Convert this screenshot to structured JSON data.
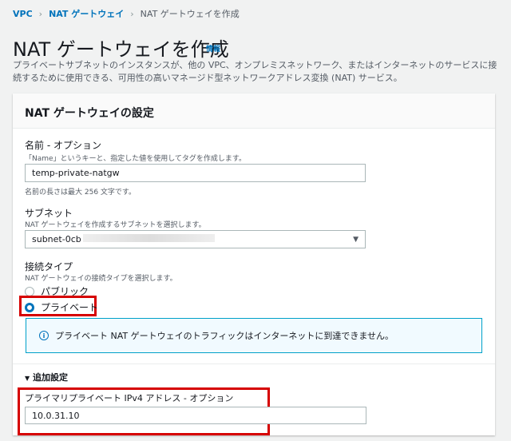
{
  "breadcrumb": {
    "items": [
      "VPC",
      "NAT ゲートウェイ"
    ],
    "current": "NAT ゲートウェイを作成"
  },
  "page": {
    "title": "NAT ゲートウェイを作成",
    "info_link": "情報",
    "description": "プライベートサブネットのインスタンスが、他の VPC、オンプレミスネットワーク、またはインターネットのサービスに接続するために使用できる、可用性の高いマネージド型ネットワークアドレス変換 (NAT) サービス。"
  },
  "settings": {
    "title": "NAT ゲートウェイの設定",
    "name": {
      "label": "名前 - オプション",
      "description": "「Name」というキーと、指定した値を使用してタグを作成します。",
      "value": "temp-private-natgw",
      "hint": "名前の長さは最大 256 文字です。"
    },
    "subnet": {
      "label": "サブネット",
      "description": "NAT ゲートウェイを作成するサブネットを選択します。",
      "value": "subnet-0cb"
    },
    "connectivity": {
      "label": "接続タイプ",
      "description": "NAT ゲートウェイの接続タイプを選択します。",
      "options": [
        "パブリック",
        "プライベート"
      ],
      "selected": "プライベート"
    },
    "alert": "プライベート NAT ゲートウェイのトラフィックはインターネットに到達できません。",
    "additional": {
      "toggle": "追加設定",
      "ipv4_label": "プライマリプライベート IPv4 アドレス - オプション",
      "ipv4_value": "10.0.31.10"
    }
  }
}
